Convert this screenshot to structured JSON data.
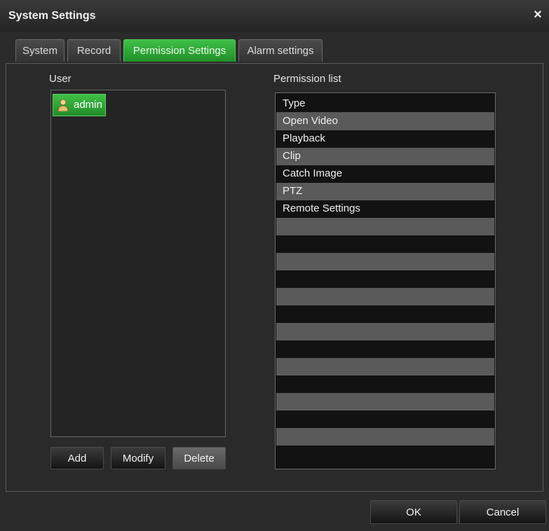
{
  "window": {
    "title": "System Settings",
    "close_label": "×"
  },
  "tabs": [
    {
      "label": "System"
    },
    {
      "label": "Record"
    },
    {
      "label": "Permission Settings"
    },
    {
      "label": "Alarm settings"
    }
  ],
  "user_panel": {
    "label": "User",
    "users": [
      {
        "name": "admin"
      }
    ],
    "buttons": {
      "add": "Add",
      "modify": "Modify",
      "delete": "Delete"
    }
  },
  "permission_panel": {
    "label": "Permission list",
    "header": "Type",
    "items": [
      "Open Video",
      "Playback",
      "Clip",
      "Catch Image",
      "PTZ",
      "Remote Settings"
    ]
  },
  "footer": {
    "ok": "OK",
    "cancel": "Cancel"
  },
  "colors": {
    "accent_green": "#2fa838",
    "background": "#2b2b2b",
    "row_alt": "#5a5a5a"
  }
}
